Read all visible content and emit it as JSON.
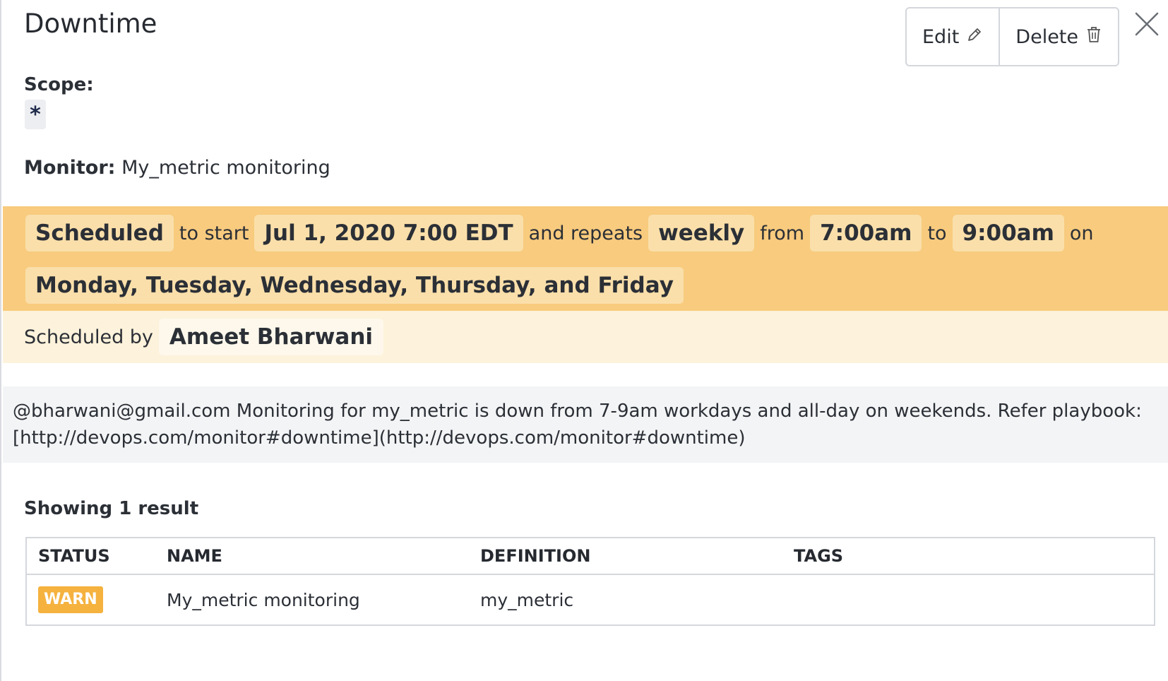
{
  "header": {
    "title": "Downtime",
    "edit_label": "Edit",
    "delete_label": "Delete"
  },
  "scope": {
    "label": "Scope:",
    "value": "*"
  },
  "monitor": {
    "label": "Monitor:",
    "value": "My_metric monitoring"
  },
  "schedule": {
    "status": "Scheduled",
    "to_start_text": "to start",
    "start": "Jul 1, 2020 7:00 EDT",
    "repeats_text": "and repeats",
    "frequency": "weekly",
    "from_text": "from",
    "from_time": "7:00am",
    "to_text": "to",
    "to_time": "9:00am",
    "on_text": "on",
    "days": "Monday, Tuesday, Wednesday, Thursday, and Friday"
  },
  "scheduled_by": {
    "label": "Scheduled by",
    "name": "Ameet Bharwani"
  },
  "message": {
    "line1": "@bharwani@gmail.com Monitoring for my_metric is down from 7-9am workdays and all-day on weekends. Refer playbook:",
    "line2": "[http://devops.com/monitor#downtime](http://devops.com/monitor#downtime)"
  },
  "results": {
    "count_text": "Showing 1 result",
    "columns": [
      "STATUS",
      "NAME",
      "DEFINITION",
      "TAGS"
    ],
    "rows": [
      {
        "status": "WARN",
        "name": "My_metric monitoring",
        "definition": "my_metric",
        "tags": ""
      }
    ]
  },
  "colors": {
    "schedule_bg": "#f8cb7e",
    "scheduled_by_bg": "#fdf2db",
    "warn": "#f5b23f"
  }
}
